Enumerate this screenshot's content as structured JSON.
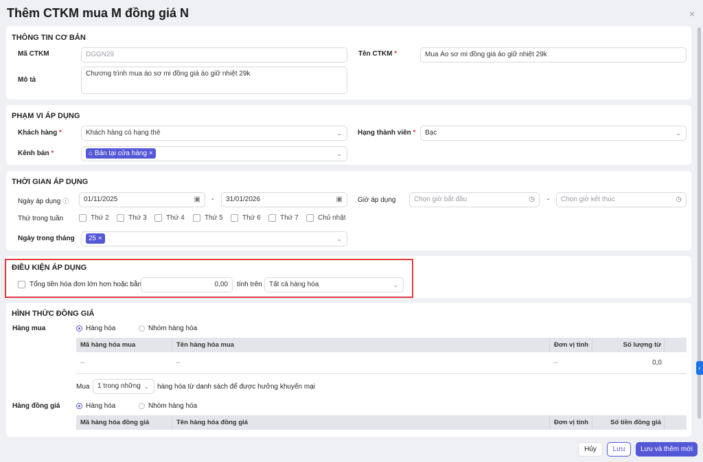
{
  "modal": {
    "title": "Thêm CTKM mua M đồng giá N",
    "close": "×"
  },
  "basic": {
    "heading": "THÔNG TIN CƠ BẢN",
    "code_label": "Mã CTKM",
    "code_value": "DGGN29",
    "name_label": "Tên CTKM",
    "name_value": "Mua Áo sơ mi đồng giá áo giữ nhiệt 29k",
    "desc_label": "Mô tả",
    "desc_value": "Chương trình mua áo sơ mi đồng giá áo giữ nhiệt 29k"
  },
  "scope": {
    "heading": "PHẠM VI ÁP DỤNG",
    "customer_label": "Khách hàng",
    "customer_value": "Khách hàng có hạng thẻ",
    "tier_label": "Hạng thành viên",
    "tier_value": "Bạc",
    "channel_label": "Kênh bán",
    "channel_tag": "Bán tại cửa hàng"
  },
  "time": {
    "heading": "THỜI GIAN ÁP DỤNG",
    "date_label": "Ngày áp dụng",
    "date_from": "01/11/2025",
    "date_to": "31/01/2026",
    "hour_label": "Giờ áp dụng",
    "hour_from_ph": "Chọn giờ bắt đầu",
    "hour_to_ph": "Chọn giờ kết thúc",
    "weekday_label": "Thứ trong tuần",
    "weekdays": [
      "Thứ 2",
      "Thứ 3",
      "Thứ 4",
      "Thứ 5",
      "Thứ 6",
      "Thứ 7",
      "Chủ nhật"
    ],
    "monthday_label": "Ngày trong tháng",
    "monthday_tag": "25"
  },
  "condition": {
    "heading": "ĐIỀU KIỆN ÁP DỤNG",
    "total_label": "Tổng tiền hóa đơn lớn hơn hoặc bằng",
    "total_value": "0,00",
    "on_label": "tính trên",
    "on_value": "Tất cả hàng hóa"
  },
  "pricing": {
    "heading": "HÌNH THỨC ĐỒNG GIÁ",
    "buy_label": "Hàng mua",
    "opt_item": "Hàng hóa",
    "opt_group": "Nhóm hàng hóa",
    "buy_cols": [
      "Mã hàng hóa mua",
      "Tên hàng hóa mua",
      "Đơn vị tính",
      "Số lượng từ"
    ],
    "buy_row": [
      "--",
      "--",
      "--",
      "0,0"
    ],
    "mua_label": "Mua",
    "mua_select": "1 trong những",
    "mua_suffix": "hàng hóa từ danh sách để được hưởng khuyến mại",
    "same_label": "Hàng đồng giá",
    "same_cols": [
      "Mã hàng hóa đồng giá",
      "Tên hàng hóa đồng giá",
      "Đơn vị tính",
      "Số tiền đồng giá"
    ]
  },
  "footer": {
    "cancel": "Hủy",
    "save": "Lưu",
    "save_new": "Lưu và thêm mới"
  },
  "colors": {
    "accent": "#5457d6",
    "highlight": "#e0383e"
  }
}
